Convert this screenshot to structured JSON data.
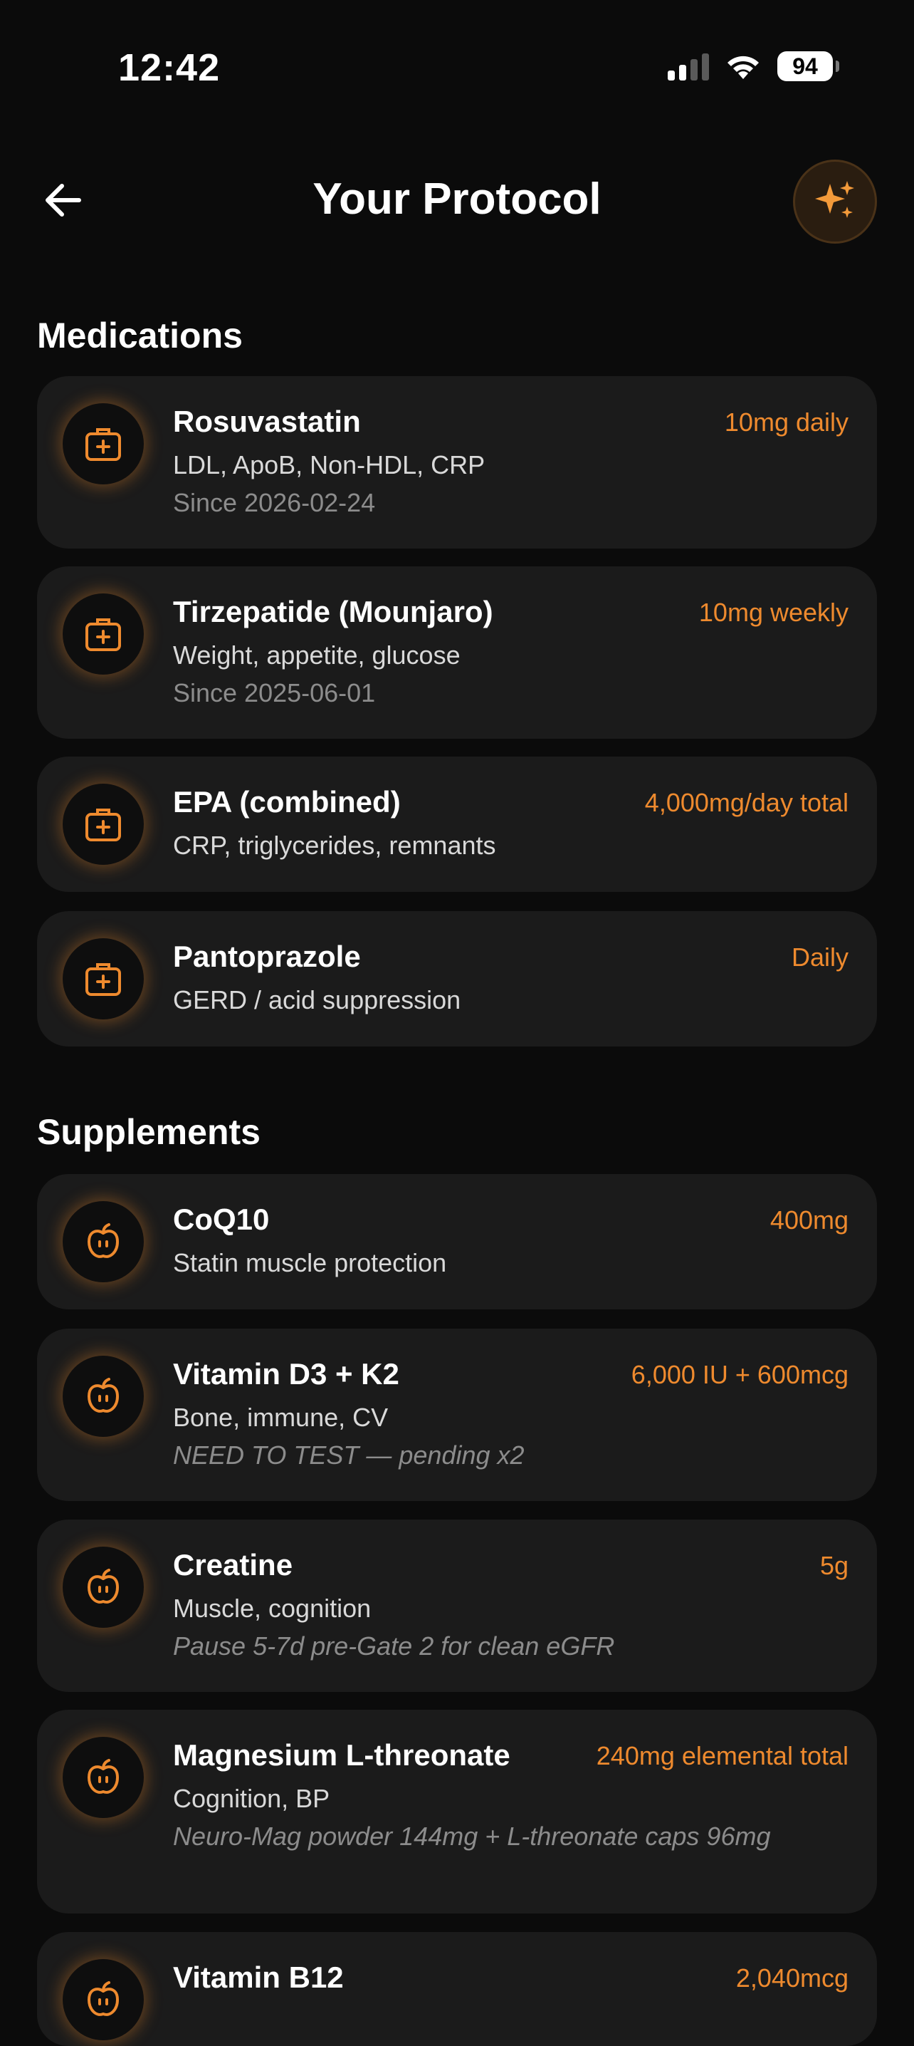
{
  "status_bar": {
    "time": "12:42",
    "battery": "94"
  },
  "header": {
    "title": "Your Protocol"
  },
  "colors": {
    "accent": "#ee8a2e",
    "card_bg": "#1b1b1b",
    "page_bg": "#0b0b0b"
  },
  "medications": {
    "title": "Medications",
    "items": [
      {
        "name": "Rosuvastatin",
        "dose": "10mg daily",
        "targets": "LDL, ApoB, Non-HDL, CRP",
        "note": "Since 2026-02-24",
        "icon": "medical-kit-icon"
      },
      {
        "name": "Tirzepatide (Mounjaro)",
        "dose": "10mg weekly",
        "targets": "Weight, appetite, glucose",
        "note": "Since 2025-06-01",
        "icon": "medical-kit-icon"
      },
      {
        "name": "EPA (combined)",
        "dose": "4,000mg/day total",
        "targets": "CRP, triglycerides, remnants",
        "icon": "medical-kit-icon"
      },
      {
        "name": "Pantoprazole",
        "dose": "Daily",
        "targets": "GERD / acid suppression",
        "icon": "medical-kit-icon"
      }
    ]
  },
  "supplements": {
    "title": "Supplements",
    "items": [
      {
        "name": "CoQ10",
        "dose": "400mg",
        "targets": "Statin muscle protection",
        "icon": "apple-icon"
      },
      {
        "name": "Vitamin D3 + K2",
        "dose": "6,000 IU + 600mcg",
        "targets": "Bone, immune, CV",
        "note": "NEED TO TEST — pending x2",
        "icon": "apple-icon"
      },
      {
        "name": "Creatine",
        "dose": "5g",
        "targets": "Muscle, cognition",
        "note": "Pause 5-7d pre-Gate 2 for clean eGFR",
        "icon": "apple-icon"
      },
      {
        "name": "Magnesium L-threonate",
        "dose": "240mg elemental total",
        "targets": "Cognition, BP",
        "note": "Neuro-Mag powder 144mg + L-threonate caps 96mg",
        "icon": "apple-icon"
      },
      {
        "name": "Vitamin B12",
        "dose": "2,040mcg",
        "icon": "apple-icon"
      }
    ]
  }
}
